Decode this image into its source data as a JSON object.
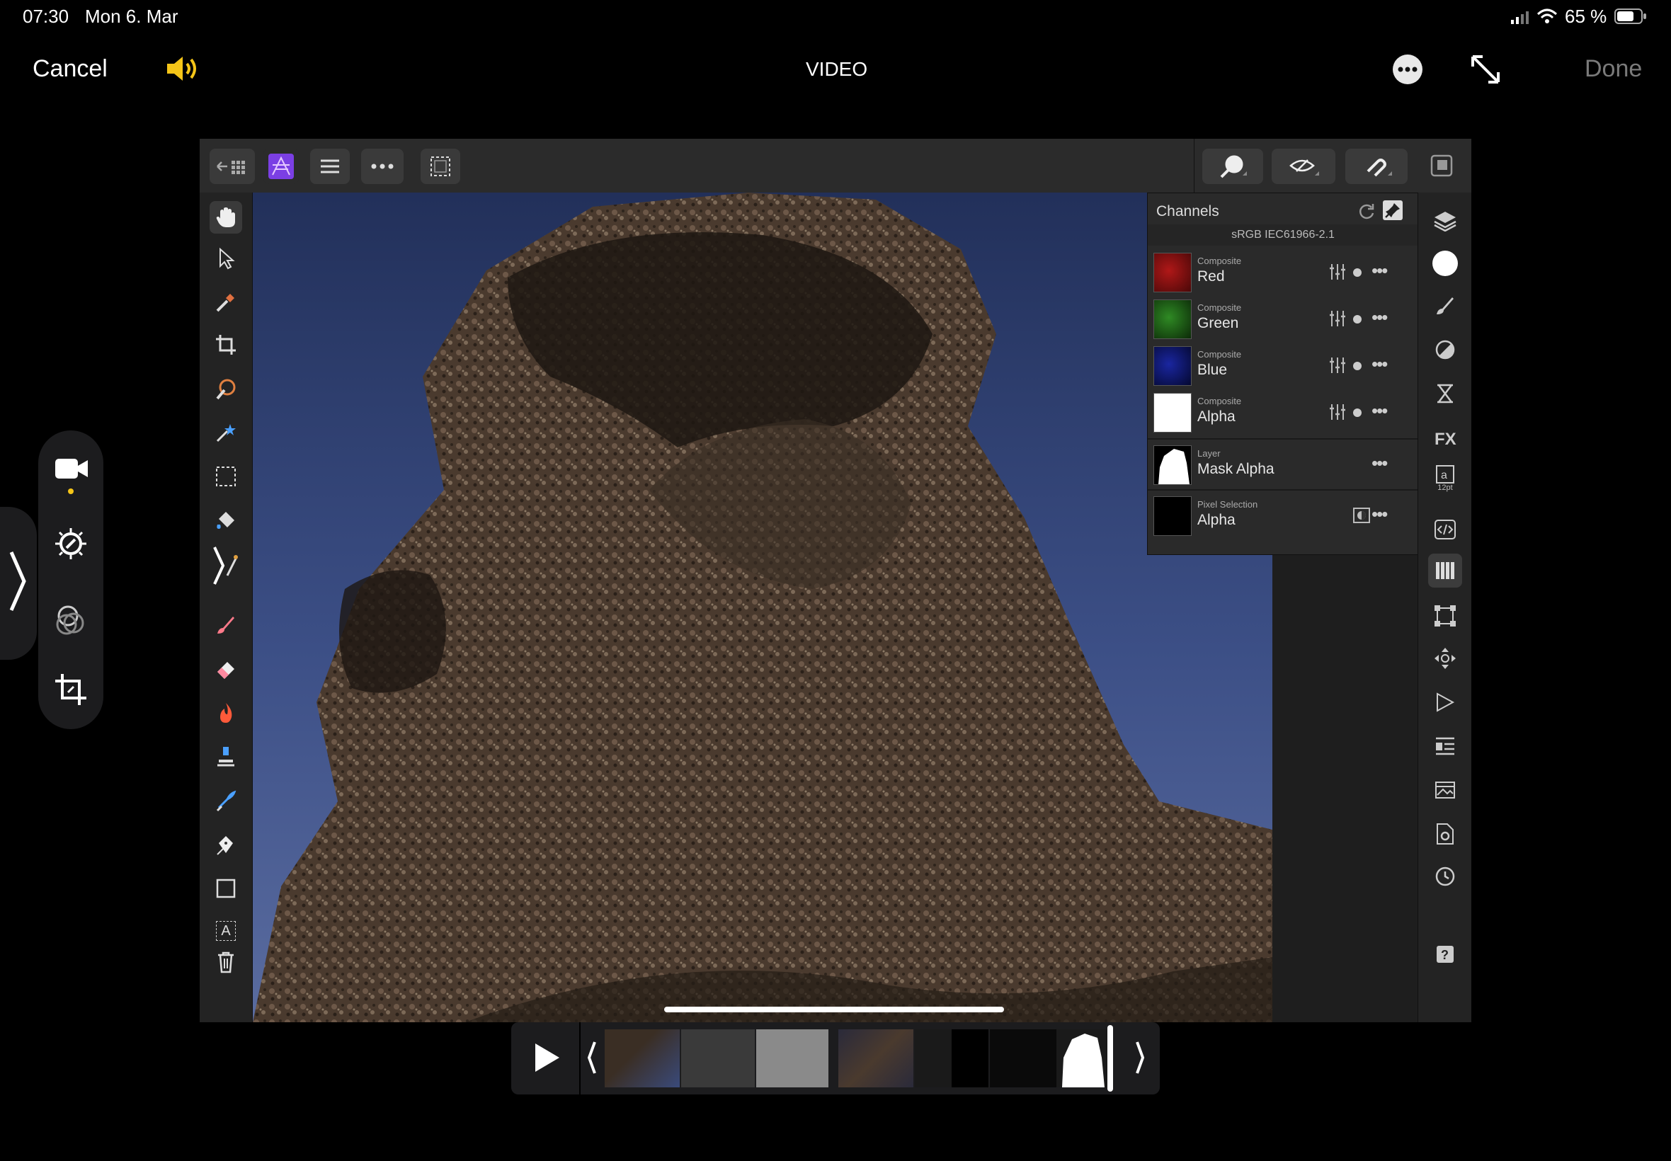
{
  "status_bar": {
    "time": "07:30",
    "date": "Mon 6. Mar",
    "battery": "65 %"
  },
  "capture_bar": {
    "cancel": "Cancel",
    "mode": "VIDEO",
    "done": "Done"
  },
  "channels_panel": {
    "title": "Channels",
    "profile": "sRGB IEC61966-2.1",
    "rows": [
      {
        "category": "Composite",
        "name": "Red",
        "color": "#8a1010"
      },
      {
        "category": "Composite",
        "name": "Green",
        "color": "#1f6a1a"
      },
      {
        "category": "Composite",
        "name": "Blue",
        "color": "#101870"
      },
      {
        "category": "Composite",
        "name": "Alpha",
        "color": "#ffffff"
      },
      {
        "category": "Layer",
        "name": "Mask Alpha",
        "color": "#ffffff"
      },
      {
        "category": "Pixel Selection",
        "name": "Alpha",
        "color": "#000000"
      }
    ]
  },
  "right_tools": {
    "text_size": "12pt"
  },
  "left_tools": {
    "text_tool_glyph": "A"
  },
  "colors": {
    "accent_yellow": "#f5c518",
    "affinity_purple": "#7b3fe4",
    "done_gray": "#7a7a7a"
  }
}
